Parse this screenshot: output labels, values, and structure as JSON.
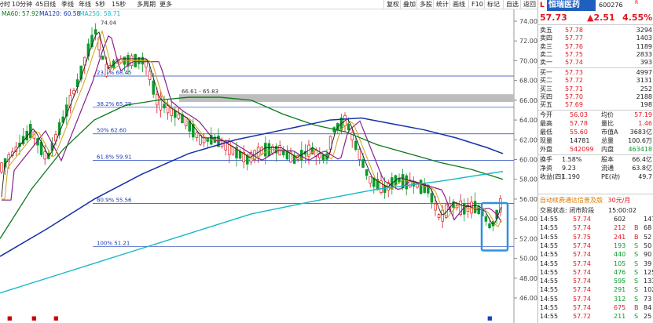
{
  "toolbar": {
    "tabs": [
      "分时",
      "10分钟",
      "45日线",
      "季线",
      "年线",
      "5秒",
      "15秒",
      "多周期",
      "更多"
    ],
    "tabs_left": [
      -3,
      15,
      45,
      78,
      100,
      121,
      142,
      174,
      203
    ],
    "buttons": [
      "复权",
      "叠加",
      "多股",
      "统计",
      "画线",
      "F10",
      "标记",
      "自选",
      "返回"
    ],
    "buttons_left": [
      488,
      509,
      530,
      551,
      572,
      596,
      616,
      640,
      662
    ]
  },
  "ma_legend": [
    {
      "text": "MA60: 57.92",
      "color": "#0a7a1a"
    },
    {
      "text": "MA120: 60.58",
      "color": "#1530a8"
    },
    {
      "text": "MA250: 58.71",
      "color": "#16b8c8"
    }
  ],
  "chart": {
    "y_ticks": [
      "74.00",
      "72.00",
      "70.00",
      "68.00",
      "66.00",
      "64.00",
      "62.00",
      "60.00",
      "58.00",
      "56.00",
      "54.00",
      "52.00",
      "50.00",
      "48.00",
      "46.00"
    ],
    "y_tick_values": [
      74,
      72,
      70,
      68,
      66,
      64,
      62,
      60,
      58,
      56,
      54,
      52,
      50,
      48,
      46
    ],
    "high_label": "74.04",
    "fib_levels": [
      {
        "label": "23.6% 68.45",
        "value": 68.45
      },
      {
        "label": "38.2% 65.29",
        "value": 65.29
      },
      {
        "label": "50% 62.60",
        "value": 62.6
      },
      {
        "label": "61.8% 59.91",
        "value": 59.91
      },
      {
        "label": "80.9% 55.56",
        "value": 55.56
      },
      {
        "label": "100% 51.21",
        "value": 51.21
      }
    ],
    "zone_label": "66.61 - 65.83",
    "zone_range": [
      65.83,
      66.61
    ],
    "colors": {
      "up": "#e0171f",
      "down": "#0a9a2a",
      "ma5": "#222222",
      "ma10": "#d4a017",
      "ma20": "#8a1f8a",
      "ma60": "#0a7a1a",
      "ma120": "#1530a8",
      "ma250": "#16b8c8",
      "fib": "#1a3fb8",
      "box": "#2f8fe0"
    }
  },
  "stock": {
    "name": "恒瑞医药",
    "code": "600276",
    "r_mark": "R",
    "price": "57.73",
    "change": "▲2.51",
    "pct": "4.55%"
  },
  "sell_orders": [
    {
      "label": "卖五",
      "price": "57.78",
      "vol": "3294"
    },
    {
      "label": "卖四",
      "price": "57.77",
      "vol": "1403"
    },
    {
      "label": "卖三",
      "price": "57.76",
      "vol": "1189"
    },
    {
      "label": "卖二",
      "price": "57.75",
      "vol": "2833"
    },
    {
      "label": "卖一",
      "price": "57.74",
      "vol": "393"
    }
  ],
  "buy_orders": [
    {
      "label": "买一",
      "price": "57.73",
      "vol": "4997"
    },
    {
      "label": "买二",
      "price": "57.72",
      "vol": "3131"
    },
    {
      "label": "买三",
      "price": "57.71",
      "vol": "252"
    },
    {
      "label": "买四",
      "price": "57.70",
      "vol": "2188"
    },
    {
      "label": "买五",
      "price": "57.69",
      "vol": "198"
    }
  ],
  "stats": [
    {
      "k1": "今开",
      "v1": "56.03",
      "c1": "red",
      "k2": "均价",
      "v2": "57.19",
      "c2": "red"
    },
    {
      "k1": "最高",
      "v1": "57.78",
      "c1": "red",
      "k2": "量比",
      "v2": "1.46",
      "c2": "red"
    },
    {
      "k1": "最低",
      "v1": "55.60",
      "c1": "red",
      "k2": "市值A",
      "v2": "3683亿",
      "c2": "dk"
    },
    {
      "k1": "现量",
      "v1": "14781",
      "c1": "dk",
      "k2": "总量",
      "v2": "100.6万",
      "c2": "dk"
    },
    {
      "k1": "外盘",
      "v1": "542099",
      "c1": "red",
      "k2": "内盘",
      "v2": "463418",
      "c2": "green"
    }
  ],
  "stats2": [
    {
      "k1": "换手",
      "v1": "1.58%",
      "k2": "股本",
      "v2": "66.4亿"
    },
    {
      "k1": "净资",
      "v1": "9.23",
      "k2": "流通",
      "v2": "63.8亿"
    },
    {
      "k1": "收益(四)",
      "v1": "1.190",
      "k2": "PE(动)",
      "v2": "49.7"
    }
  ],
  "ad_text": "自动续费通达信普及版",
  "ad_price": "30元/月",
  "trade_status": "交易状态: 闭市阶段",
  "trade_time": "15:00:02",
  "ticks": [
    {
      "t": "14:55",
      "p": "57.74",
      "v": "602",
      "s": "",
      "n": "147"
    },
    {
      "t": "14:55",
      "p": "57.74",
      "v": "212",
      "s": "B",
      "n": "68"
    },
    {
      "t": "14:55",
      "p": "57.75",
      "v": "241",
      "s": "B",
      "n": "52"
    },
    {
      "t": "14:55",
      "p": "57.74",
      "v": "193",
      "s": "S",
      "n": "50"
    },
    {
      "t": "14:55",
      "p": "57.74",
      "v": "440",
      "s": "S",
      "n": "90"
    },
    {
      "t": "14:55",
      "p": "57.74",
      "v": "105",
      "s": "S",
      "n": "39"
    },
    {
      "t": "14:55",
      "p": "57.74",
      "v": "476",
      "s": "S",
      "n": "125"
    },
    {
      "t": "14:55",
      "p": "57.74",
      "v": "595",
      "s": "S",
      "n": "133"
    },
    {
      "t": "14:55",
      "p": "57.74",
      "v": "291",
      "s": "S",
      "n": "102"
    },
    {
      "t": "14:55",
      "p": "57.74",
      "v": "312",
      "s": "S",
      "n": "73"
    },
    {
      "t": "14:55",
      "p": "57.74",
      "v": "675",
      "s": "B",
      "n": "84"
    },
    {
      "t": "14:55",
      "p": "57.72",
      "v": "211",
      "s": "S",
      "n": "25"
    }
  ]
}
